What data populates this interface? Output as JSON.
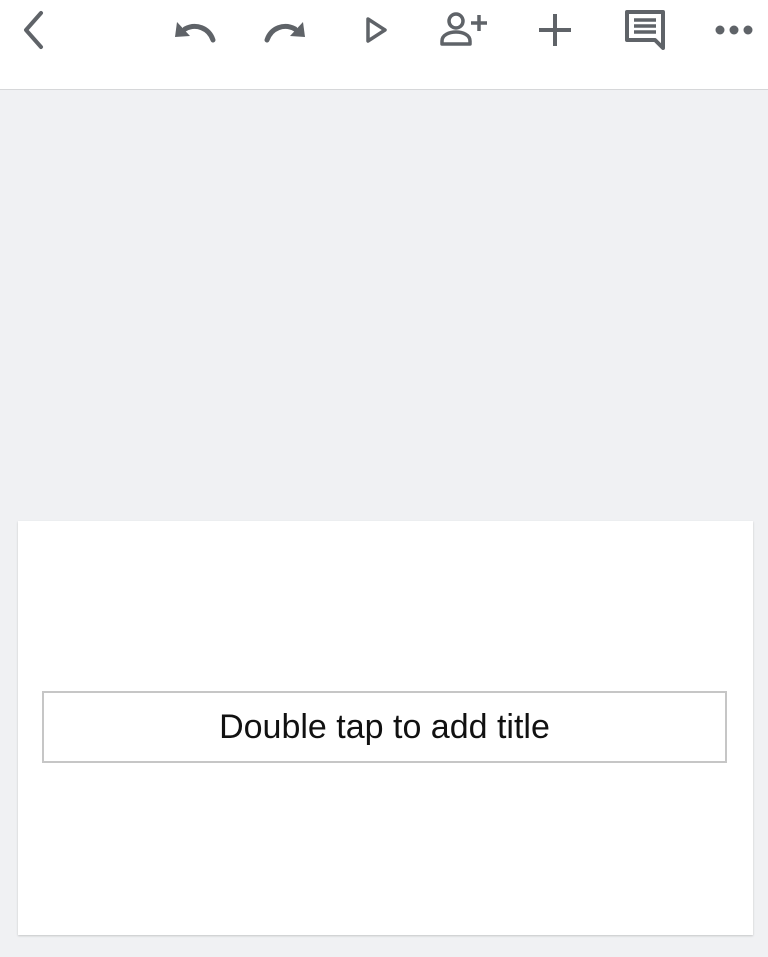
{
  "toolbar": {
    "buttons": [
      {
        "name": "back-icon",
        "label": "Back"
      },
      {
        "name": "undo-icon",
        "label": "Undo"
      },
      {
        "name": "redo-icon",
        "label": "Redo"
      },
      {
        "name": "play-icon",
        "label": "Present"
      },
      {
        "name": "add-person-icon",
        "label": "Share"
      },
      {
        "name": "plus-icon",
        "label": "Insert"
      },
      {
        "name": "comment-icon",
        "label": "Comment"
      },
      {
        "name": "more-icon",
        "label": "More options"
      }
    ],
    "icon_color": "#5f6368"
  },
  "slide": {
    "title_placeholder": "Double tap to add title"
  }
}
